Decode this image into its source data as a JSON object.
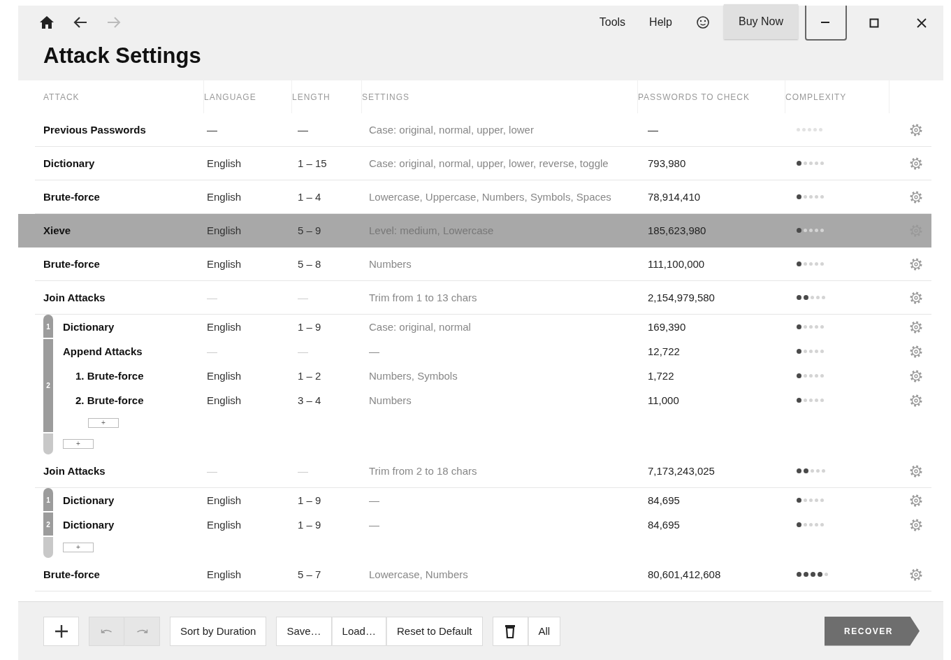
{
  "nav": {
    "forward": {
      "disabled": true
    }
  },
  "menu": [
    "Tools",
    "Help"
  ],
  "buy_button": "Buy Now",
  "title": "Attack Settings",
  "columns": [
    "ATTACK",
    "LANGUAGE",
    "LENGTH",
    "SETTINGS",
    "PASSWORDS TO CHECK",
    "COMPLEXITY"
  ],
  "rows": [
    {
      "kind": "attack",
      "attack": "Previous Passwords",
      "language": "—",
      "length": "—",
      "settings": "Case: original, normal, upper, lower",
      "passwords": "—",
      "stars": 0,
      "selected": false
    },
    {
      "kind": "attack",
      "attack": "Dictionary",
      "language": "English",
      "length": "1 – 15",
      "settings": "Case: original, normal, upper, lower, reverse, toggle",
      "passwords": "793,980",
      "stars": 1,
      "selected": false
    },
    {
      "kind": "attack",
      "attack": "Brute-force",
      "language": "English",
      "length": "1 – 4",
      "settings": "Lowercase, Uppercase, Numbers, Symbols, Spaces",
      "passwords": "78,914,410",
      "stars": 1,
      "selected": false
    },
    {
      "kind": "attack",
      "attack": "Xieve",
      "language": "English",
      "length": "5 – 9",
      "settings": "Level: medium, Lowercase",
      "passwords": "185,623,980",
      "stars": 1,
      "selected": true
    },
    {
      "kind": "attack",
      "attack": "Brute-force",
      "language": "English",
      "length": "5 – 8",
      "settings": "Numbers",
      "passwords": "111,100,000",
      "stars": 1,
      "selected": false
    },
    {
      "kind": "join",
      "attack": "Join Attacks",
      "language": "—",
      "length": "—",
      "settings": "Trim from 1 to 13 chars",
      "passwords": "2,154,979,580",
      "stars": 2,
      "selected": false,
      "add": "+",
      "parts": [
        {
          "index": "1",
          "row": {
            "kind": "attack",
            "attack": "Dictionary",
            "language": "English",
            "length": "1 – 9",
            "settings": "Case: original, normal",
            "passwords": "169,390",
            "stars": 1,
            "selected": false
          }
        },
        {
          "index": "2",
          "row": {
            "kind": "append",
            "attack": "Append Attacks",
            "language": "—",
            "length": "—",
            "settings": "—",
            "passwords": "12,722",
            "stars": 1,
            "selected": false,
            "add": "+",
            "children": [
              {
                "kind": "attack",
                "attack": "1. Brute-force",
                "language": "English",
                "length": "1 – 2",
                "settings": "Numbers, Symbols",
                "passwords": "1,722",
                "stars": 1,
                "selected": false
              },
              {
                "kind": "attack",
                "attack": "2. Brute-force",
                "language": "English",
                "length": "3 – 4",
                "settings": "Numbers",
                "passwords": "11,000",
                "stars": 1,
                "selected": false
              }
            ]
          }
        }
      ]
    },
    {
      "kind": "join",
      "attack": "Join Attacks",
      "language": "—",
      "length": "—",
      "settings": "Trim from 2 to 18 chars",
      "passwords": "7,173,243,025",
      "stars": 2,
      "selected": false,
      "add": "+",
      "parts": [
        {
          "index": "1",
          "row": {
            "kind": "attack",
            "attack": "Dictionary",
            "language": "English",
            "length": "1 – 9",
            "settings": "—",
            "passwords": "84,695",
            "stars": 1,
            "selected": false
          }
        },
        {
          "index": "2",
          "row": {
            "kind": "attack",
            "attack": "Dictionary",
            "language": "English",
            "length": "1 – 9",
            "settings": "—",
            "passwords": "84,695",
            "stars": 1,
            "selected": false
          }
        }
      ]
    },
    {
      "kind": "attack",
      "attack": "Brute-force",
      "language": "English",
      "length": "5 – 7",
      "settings": "Lowercase, Numbers",
      "passwords": "80,601,412,608",
      "stars": 4,
      "selected": false
    }
  ],
  "footer": {
    "undo": {
      "disabled": true
    },
    "redo": {
      "disabled": true
    },
    "sort_button": "Sort by Duration",
    "save_button": "Save…",
    "load_button": "Load…",
    "reset_button": "Reset to Default",
    "delete_all_button": "All",
    "recover_button": "RECOVER"
  }
}
